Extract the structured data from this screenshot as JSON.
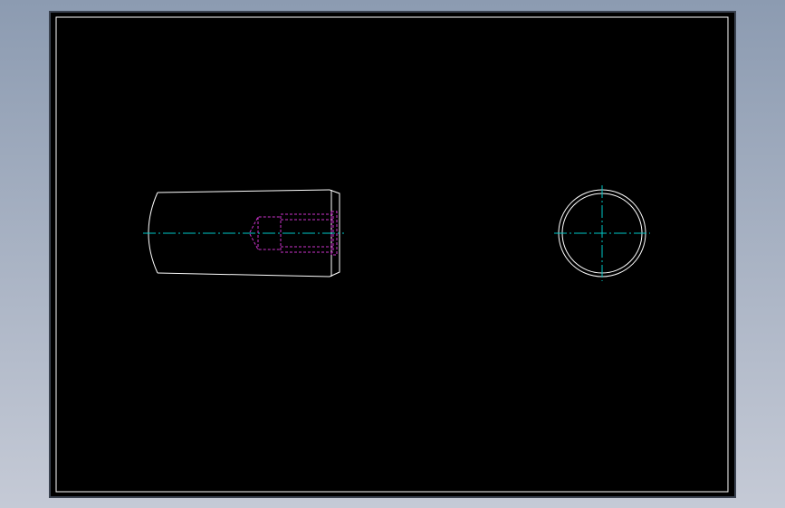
{
  "colors": {
    "background_top": "#8c9bb1",
    "background_bottom": "#c5cad6",
    "paper": "#000000",
    "paper_border": "#3a4250",
    "frame": "#ffffff",
    "outline": "#ffffff",
    "hidden_line": "#cc33cc",
    "center_line": "#00c8c8"
  },
  "icons": [],
  "views": [
    {
      "name": "side-view",
      "shape": "pin-cylinder",
      "features": [
        "rounded-left-end",
        "chamfered-right-end",
        "threaded-blind-hole"
      ]
    },
    {
      "name": "end-view",
      "shape": "circle",
      "features": [
        "outer-circle",
        "chamfer-circle",
        "centerlines"
      ]
    }
  ]
}
